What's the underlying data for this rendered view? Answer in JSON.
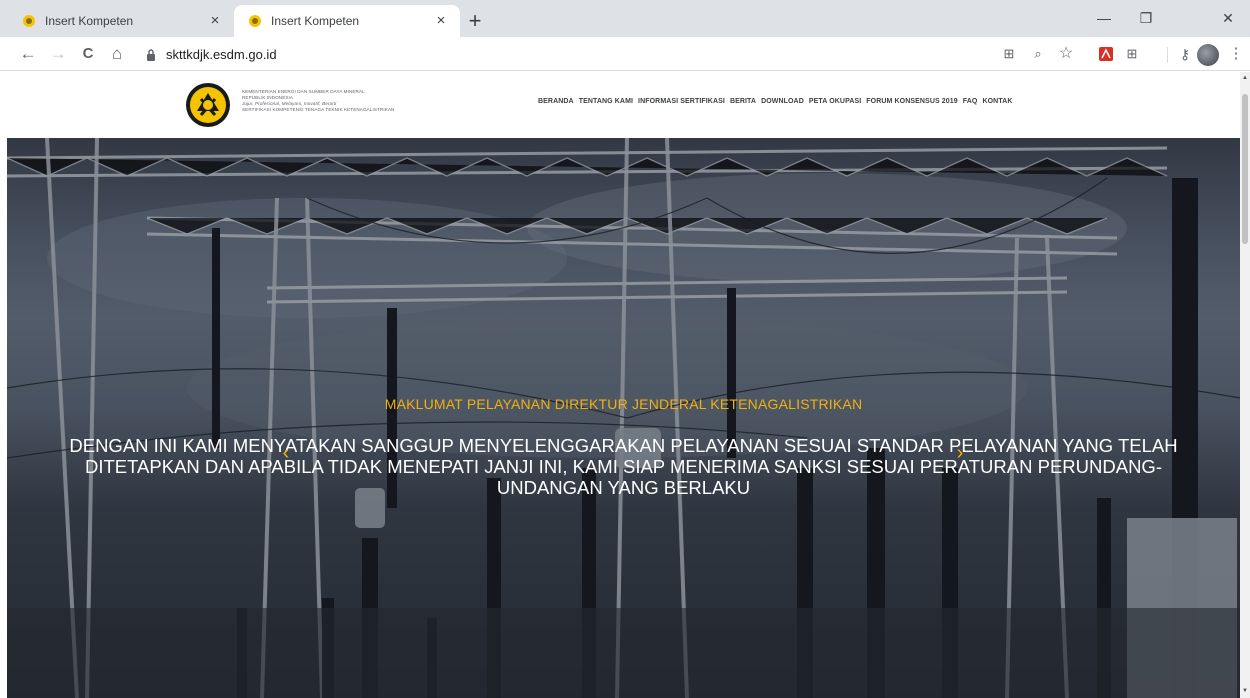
{
  "browser": {
    "tabs": [
      {
        "title": "Insert Kompeten",
        "close": "×"
      },
      {
        "title": "Insert Kompeten",
        "close": "×"
      }
    ],
    "new_tab": "+",
    "window_controls": {
      "minimize": "—",
      "maximize": "❐",
      "close": "✕"
    },
    "nav": {
      "back": "←",
      "forward": "→",
      "reload": "C",
      "home": "⌂"
    },
    "url": "skttkdjk.esdm.go.id",
    "toolbar_icons": [
      "translate-icon",
      "zoom-icon",
      "star-icon",
      "pdf-extension-icon",
      "apps-extension-icon",
      "key-icon",
      "profile-avatar",
      "more-menu-icon"
    ],
    "toolbar_glyphs": {
      "translate": "⊞",
      "zoom": "⌕",
      "star": "☆",
      "apps": "⊞",
      "key": "⚷",
      "more": "⋮"
    }
  },
  "site": {
    "org_lines": [
      "KEMENTERIAN ENERGI DAN SUMBER DAYA MINERAL",
      "REPUBLIK INDONESIA",
      "Jujur, Profesional, Melayani, Inovatif, Berarti",
      "SERTIFIKASI KOMPETENSI TENAGA TEKNIK KETENAGALISTRIKAN"
    ],
    "nav": [
      "BERANDA",
      "TENTANG KAMI",
      "INFORMASI SERTIFIKASI",
      "BERITA",
      "DOWNLOAD",
      "PETA OKUPASI",
      "FORUM KONSENSUS 2019",
      "FAQ",
      "KONTAK"
    ]
  },
  "hero": {
    "subtitle": "MAKLUMAT PELAYANAN DIREKTUR JENDERAL KETENAGALISTRIKAN",
    "title": "DENGAN INI KAMI MENYATAKAN SANGGUP MENYELENGGARAKAN PELAYANAN SESUAI STANDAR PELAYANAN YANG TELAH DITETAPKAN DAN APABILA TIDAK MENEPATI JANJI INI, KAMI SIAP MENERIMA SANKSI SESUAI PERATURAN PERUNDANG-UNDANGAN YANG BERLAKU",
    "prev": "‹",
    "next": "›"
  },
  "colors": {
    "accent": "#f2b00f",
    "tabstrip": "#dee1e6",
    "logo_yellow": "#f5c400",
    "logo_black": "#1a1a1a"
  }
}
